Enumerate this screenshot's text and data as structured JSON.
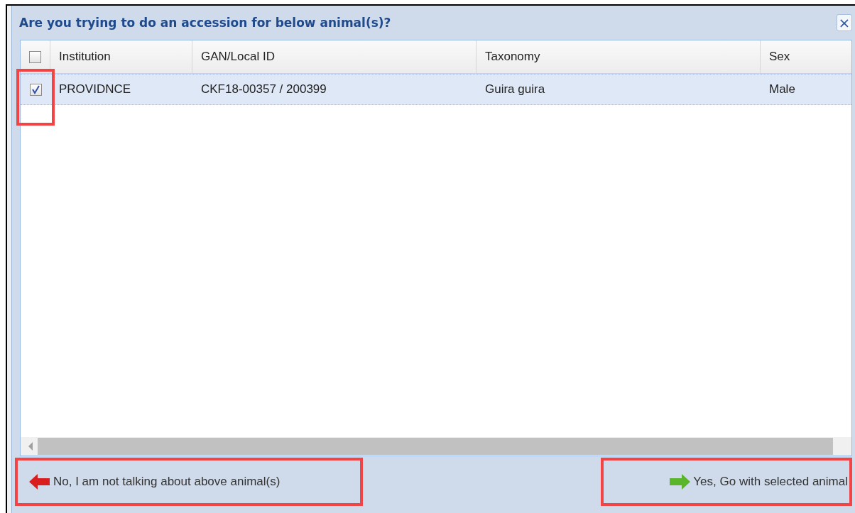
{
  "dialog": {
    "title": "Are you trying to do an accession for below animal(s)?",
    "close": "×"
  },
  "table": {
    "select_all_checked": false,
    "columns": [
      "Institution",
      "GAN/Local ID",
      "Taxonomy",
      "Sex"
    ],
    "rows": [
      {
        "checked": true,
        "selected": true,
        "highlighted": true,
        "cells": [
          "PROVIDNCE",
          "CKF18-00357 / 200399",
          "Guira guira",
          "Male"
        ]
      }
    ]
  },
  "buttons": [
    {
      "kind": "back",
      "label": "No, I am not talking about above animal(s)",
      "highlighted": true
    },
    {
      "kind": "forward",
      "label": "Yes, Go with selected animal",
      "highlighted": true
    }
  ]
}
